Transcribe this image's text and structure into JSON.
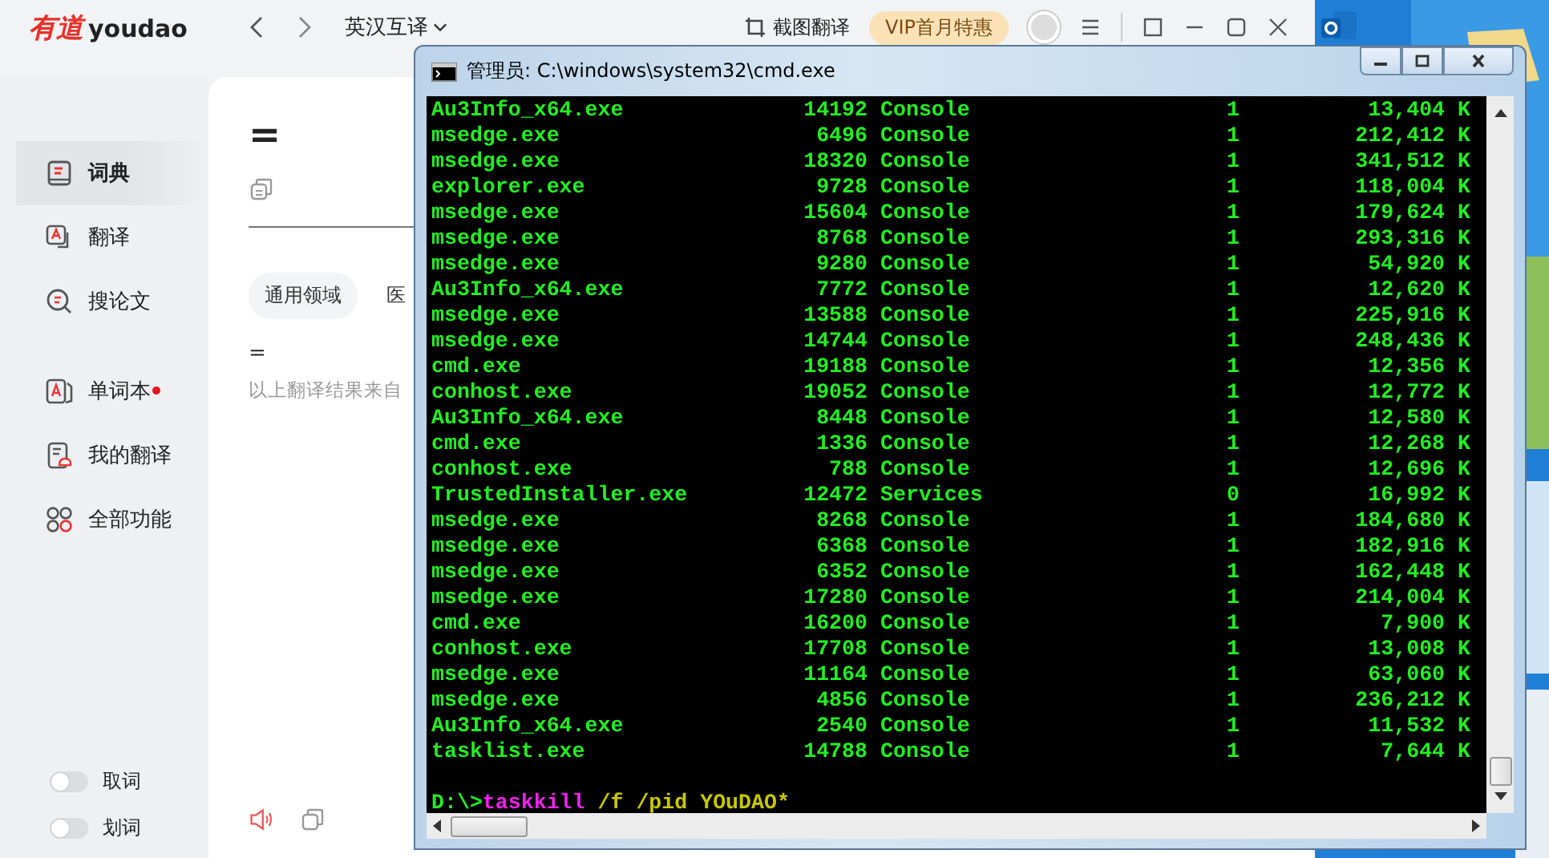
{
  "youdao": {
    "logo_cn": "有道",
    "logo_en": "youdao",
    "mode": "英汉互译",
    "screenshot_translate": "截图翻译",
    "vip": "VIP首月特惠",
    "sidebar": [
      {
        "label": "词典",
        "selected": true,
        "badge": false
      },
      {
        "label": "翻译",
        "selected": false,
        "badge": false
      },
      {
        "label": "搜论文",
        "selected": false,
        "badge": false
      },
      {
        "label": "单词本",
        "selected": false,
        "badge": true
      },
      {
        "label": "我的翻译",
        "selected": false,
        "badge": false
      },
      {
        "label": "全部功能",
        "selected": false,
        "badge": false
      }
    ],
    "toggles": [
      {
        "label": "取词",
        "on": false
      },
      {
        "label": "划词",
        "on": false
      }
    ],
    "query": "=",
    "domains": [
      {
        "label": "通用领域",
        "selected": true
      },
      {
        "label": "医",
        "selected": false
      }
    ],
    "result": "=",
    "source_note": "以上翻译结果来自"
  },
  "cmd": {
    "title": "管理员: C:\\windows\\system32\\cmd.exe",
    "rows": [
      {
        "image": "Au3Info_x64.exe",
        "pid": "14192",
        "session": "Console",
        "session_no": "1",
        "mem": "13,404 K"
      },
      {
        "image": "msedge.exe",
        "pid": "6496",
        "session": "Console",
        "session_no": "1",
        "mem": "212,412 K"
      },
      {
        "image": "msedge.exe",
        "pid": "18320",
        "session": "Console",
        "session_no": "1",
        "mem": "341,512 K"
      },
      {
        "image": "explorer.exe",
        "pid": "9728",
        "session": "Console",
        "session_no": "1",
        "mem": "118,004 K"
      },
      {
        "image": "msedge.exe",
        "pid": "15604",
        "session": "Console",
        "session_no": "1",
        "mem": "179,624 K"
      },
      {
        "image": "msedge.exe",
        "pid": "8768",
        "session": "Console",
        "session_no": "1",
        "mem": "293,316 K"
      },
      {
        "image": "msedge.exe",
        "pid": "9280",
        "session": "Console",
        "session_no": "1",
        "mem": "54,920 K"
      },
      {
        "image": "Au3Info_x64.exe",
        "pid": "7772",
        "session": "Console",
        "session_no": "1",
        "mem": "12,620 K"
      },
      {
        "image": "msedge.exe",
        "pid": "13588",
        "session": "Console",
        "session_no": "1",
        "mem": "225,916 K"
      },
      {
        "image": "msedge.exe",
        "pid": "14744",
        "session": "Console",
        "session_no": "1",
        "mem": "248,436 K"
      },
      {
        "image": "cmd.exe",
        "pid": "19188",
        "session": "Console",
        "session_no": "1",
        "mem": "12,356 K"
      },
      {
        "image": "conhost.exe",
        "pid": "19052",
        "session": "Console",
        "session_no": "1",
        "mem": "12,772 K"
      },
      {
        "image": "Au3Info_x64.exe",
        "pid": "8448",
        "session": "Console",
        "session_no": "1",
        "mem": "12,580 K"
      },
      {
        "image": "cmd.exe",
        "pid": "1336",
        "session": "Console",
        "session_no": "1",
        "mem": "12,268 K"
      },
      {
        "image": "conhost.exe",
        "pid": "788",
        "session": "Console",
        "session_no": "1",
        "mem": "12,696 K"
      },
      {
        "image": "TrustedInstaller.exe",
        "pid": "12472",
        "session": "Services",
        "session_no": "0",
        "mem": "16,992 K"
      },
      {
        "image": "msedge.exe",
        "pid": "8268",
        "session": "Console",
        "session_no": "1",
        "mem": "184,680 K"
      },
      {
        "image": "msedge.exe",
        "pid": "6368",
        "session": "Console",
        "session_no": "1",
        "mem": "182,916 K"
      },
      {
        "image": "msedge.exe",
        "pid": "6352",
        "session": "Console",
        "session_no": "1",
        "mem": "162,448 K"
      },
      {
        "image": "msedge.exe",
        "pid": "17280",
        "session": "Console",
        "session_no": "1",
        "mem": "214,004 K"
      },
      {
        "image": "cmd.exe",
        "pid": "16200",
        "session": "Console",
        "session_no": "1",
        "mem": "7,900 K"
      },
      {
        "image": "conhost.exe",
        "pid": "17708",
        "session": "Console",
        "session_no": "1",
        "mem": "13,008 K"
      },
      {
        "image": "msedge.exe",
        "pid": "11164",
        "session": "Console",
        "session_no": "1",
        "mem": "63,060 K"
      },
      {
        "image": "msedge.exe",
        "pid": "4856",
        "session": "Console",
        "session_no": "1",
        "mem": "236,212 K"
      },
      {
        "image": "Au3Info_x64.exe",
        "pid": "2540",
        "session": "Console",
        "session_no": "1",
        "mem": "11,532 K"
      },
      {
        "image": "tasklist.exe",
        "pid": "14788",
        "session": "Console",
        "session_no": "1",
        "mem": "7,644 K"
      }
    ],
    "prompt": [
      {
        "kind": "path",
        "text": "D:\\>"
      },
      {
        "kind": "command",
        "text": "taskkill"
      },
      {
        "kind": "args",
        "text": "/f /pid YOuDAO*"
      }
    ]
  }
}
